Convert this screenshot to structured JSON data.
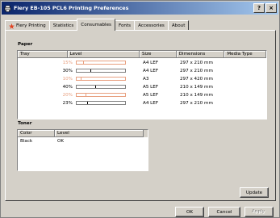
{
  "window": {
    "title": "Fiery EB-105 PCL6 Printing Preferences",
    "help_btn": "?",
    "close_btn": "×"
  },
  "tabs": [
    {
      "label": "Fiery Printing",
      "active": false
    },
    {
      "label": "Statistics",
      "active": false
    },
    {
      "label": "Consumables",
      "active": true
    },
    {
      "label": "Fonts",
      "active": false
    },
    {
      "label": "Accessories",
      "active": false
    },
    {
      "label": "About",
      "active": false
    }
  ],
  "paper": {
    "group_label": "Paper",
    "columns": [
      "Tray",
      "Level",
      "Size",
      "Dimensions",
      "Media Type"
    ],
    "rows": [
      {
        "tray": "",
        "level_text": "15%",
        "level": 15,
        "low": true,
        "size": "A4 LEF",
        "dimensions": "297 x 210 mm",
        "media": ""
      },
      {
        "tray": "",
        "level_text": "30%",
        "level": 30,
        "low": false,
        "size": "A4 LEF",
        "dimensions": "297 x 210 mm",
        "media": ""
      },
      {
        "tray": "",
        "level_text": "10%",
        "level": 10,
        "low": true,
        "size": "A3",
        "dimensions": "297 x 420 mm",
        "media": ""
      },
      {
        "tray": "",
        "level_text": "40%",
        "level": 40,
        "low": false,
        "size": "A5 LEF",
        "dimensions": "210 x 149 mm",
        "media": ""
      },
      {
        "tray": "",
        "level_text": "20%",
        "level": 20,
        "low": true,
        "size": "A5 LEF",
        "dimensions": "210 x 149 mm",
        "media": ""
      },
      {
        "tray": "",
        "level_text": "23%",
        "level": 23,
        "low": false,
        "size": "A4 LEF",
        "dimensions": "297 x 210 mm",
        "media": ""
      }
    ]
  },
  "toner": {
    "group_label": "Toner",
    "columns": [
      "Color",
      "Level"
    ],
    "rows": [
      {
        "color": "Black",
        "level": "OK"
      }
    ]
  },
  "buttons": {
    "update": "Update",
    "ok": "OK",
    "cancel": "Cancel",
    "apply": "Apply"
  },
  "colors": {
    "low_level": "#e8a080",
    "normal_level": "#000000"
  }
}
